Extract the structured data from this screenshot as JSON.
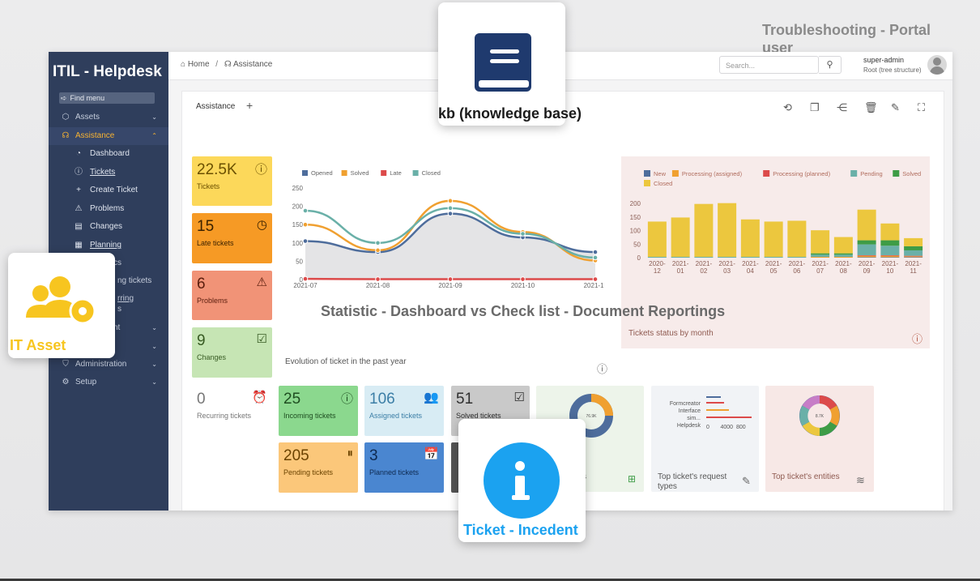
{
  "page": {
    "ghost_title": "Troubleshooting - Portal user",
    "overlay_statistic": "Statistic - Dashboard vs Check list - Document Reportings"
  },
  "overlays": {
    "kb_label": "kb (knowledge base)",
    "asset_label": "IT Asset",
    "ticket_label": "Ticket - Incedent",
    "kb_color": "#1f3a6e",
    "asset_color": "#f7c51f",
    "ticket_color": "#1ba2f0"
  },
  "sidebar": {
    "brand": "ITIL - Helpdesk",
    "find_menu": "Find menu",
    "items": [
      {
        "label": "Assets",
        "icon": "cube-icon"
      },
      {
        "label": "Assistance",
        "icon": "headset-icon",
        "active": true
      },
      {
        "label": "nt",
        "icon": "box-icon"
      },
      {
        "label": "",
        "icon": "tools-icon"
      },
      {
        "label": "Administration",
        "icon": "shield-icon"
      },
      {
        "label": "Setup",
        "icon": "gear-icon"
      }
    ],
    "subitems": [
      {
        "label": "Dashboard",
        "icon": "gauge-icon"
      },
      {
        "label": "Tickets",
        "icon": "alert-circle-icon"
      },
      {
        "label": "Create Ticket",
        "icon": "plus-icon"
      },
      {
        "label": "Problems",
        "icon": "warning-icon"
      },
      {
        "label": "Changes",
        "icon": "clipboard-icon"
      },
      {
        "label": "Planning",
        "icon": "calendar-icon"
      },
      {
        "label": "cs",
        "icon": "chart-icon"
      },
      {
        "label": "ng tickets",
        "icon": "clock-icon"
      },
      {
        "label": "rring",
        "icon": "refresh-icon"
      },
      {
        "label": "s",
        "icon": "list-icon"
      }
    ]
  },
  "header": {
    "breadcrumb_home": "Home",
    "breadcrumb_current": "Assistance",
    "search_placeholder": "Search...",
    "user_name": "super-admin",
    "user_entity": "Root (tree structure)"
  },
  "dashboard": {
    "tab_label": "Assistance",
    "stat_cards": [
      {
        "value": "22.5K",
        "label": "Tickets",
        "bg": "#fcd85a",
        "fg": "#6b5000",
        "icon": "alert-circle-icon"
      },
      {
        "value": "15",
        "label": "Late tickets",
        "bg": "#f69a25",
        "fg": "#3b2200",
        "icon": "clock-icon"
      },
      {
        "value": "6",
        "label": "Problems",
        "bg": "#f19377",
        "fg": "#5a1d0d",
        "icon": "warning-icon"
      },
      {
        "value": "9",
        "label": "Changes",
        "bg": "#c6e5b4",
        "fg": "#375a22",
        "icon": "clipboard-check-icon"
      }
    ],
    "small_cards": [
      {
        "value": "0",
        "label": "Recurring tickets",
        "bg": "#ffffff",
        "fg": "#777777",
        "icon": "alarm-icon"
      },
      {
        "value": "25",
        "label": "Incoming tickets",
        "bg": "#8bd88e",
        "fg": "#1e4d20",
        "icon": "alert-circle-icon"
      },
      {
        "value": "106",
        "label": "Assigned tickets",
        "bg": "#d8ecf4",
        "fg": "#3b7ea6",
        "icon": "users-icon"
      },
      {
        "value": "51",
        "label": "Solved tickets",
        "bg": "#c9c9c9",
        "fg": "#2f2f2f",
        "icon": "check-square-icon"
      },
      {
        "value": "205",
        "label": "Pending tickets",
        "bg": "#fbc77a",
        "fg": "#6b4300",
        "icon": "pause-icon"
      },
      {
        "value": "3",
        "label": "Planned tickets",
        "bg": "#4a86d0",
        "fg": "#0e2a50",
        "icon": "calendar-check-icon"
      }
    ],
    "line_chart_title": "Evolution of ticket in the past year",
    "bar_chart_title": "Tickets status by month",
    "widget_request_types": "Top ticket's request types",
    "widget_entities": "Top ticket's entities",
    "widget_cat_tail": "s",
    "donut_center": "76.9K",
    "donut2_center": "8.7K"
  },
  "chart_data": [
    {
      "type": "line",
      "title": "Evolution of ticket in the past year",
      "x": [
        "2021-07",
        "2021-08",
        "2021-09",
        "2021-10",
        "2021-11"
      ],
      "ylim": [
        0,
        250
      ],
      "yticks": [
        0,
        50,
        100,
        150,
        200,
        250
      ],
      "series": [
        {
          "name": "Opened",
          "color": "#4e6d9c",
          "values": [
            105,
            75,
            180,
            115,
            75
          ]
        },
        {
          "name": "Solved",
          "color": "#f0a030",
          "values": [
            150,
            80,
            215,
            130,
            52
          ]
        },
        {
          "name": "Late",
          "color": "#dc4a4a",
          "values": [
            2,
            1,
            1,
            1,
            1
          ]
        },
        {
          "name": "Closed",
          "color": "#6ab0a8",
          "values": [
            188,
            100,
            195,
            125,
            60
          ]
        }
      ]
    },
    {
      "type": "bar",
      "title": "Tickets status by month",
      "categories": [
        "2020-12",
        "2021-01",
        "2021-02",
        "2021-03",
        "2021-04",
        "2021-05",
        "2021-06",
        "2021-07",
        "2021-08",
        "2021-09",
        "2021-10",
        "2021-11"
      ],
      "ylim": [
        0,
        200
      ],
      "yticks": [
        0,
        50,
        100,
        150,
        200
      ],
      "series": [
        {
          "name": "New",
          "color": "#4e6d9c",
          "values": [
            0,
            0,
            0,
            0,
            0,
            0,
            0,
            0,
            0,
            2,
            2,
            2
          ]
        },
        {
          "name": "Processing (assigned)",
          "color": "#f0a030",
          "values": [
            0,
            0,
            0,
            0,
            0,
            0,
            0,
            3,
            3,
            5,
            5,
            3
          ]
        },
        {
          "name": "Processing (planned)",
          "color": "#dc4a4a",
          "values": [
            0,
            0,
            0,
            0,
            0,
            0,
            0,
            0,
            0,
            2,
            2,
            2
          ]
        },
        {
          "name": "Pending",
          "color": "#6ab0a8",
          "values": [
            3,
            3,
            3,
            3,
            3,
            3,
            3,
            8,
            8,
            40,
            35,
            20
          ]
        },
        {
          "name": "Solved",
          "color": "#3e9c46",
          "values": [
            0,
            0,
            0,
            0,
            0,
            0,
            0,
            5,
            5,
            15,
            20,
            15
          ]
        },
        {
          "name": "Closed",
          "color": "#ecc73e",
          "values": [
            130,
            145,
            195,
            198,
            138,
            130,
            133,
            85,
            60,
            113,
            62,
            30
          ]
        }
      ]
    }
  ]
}
